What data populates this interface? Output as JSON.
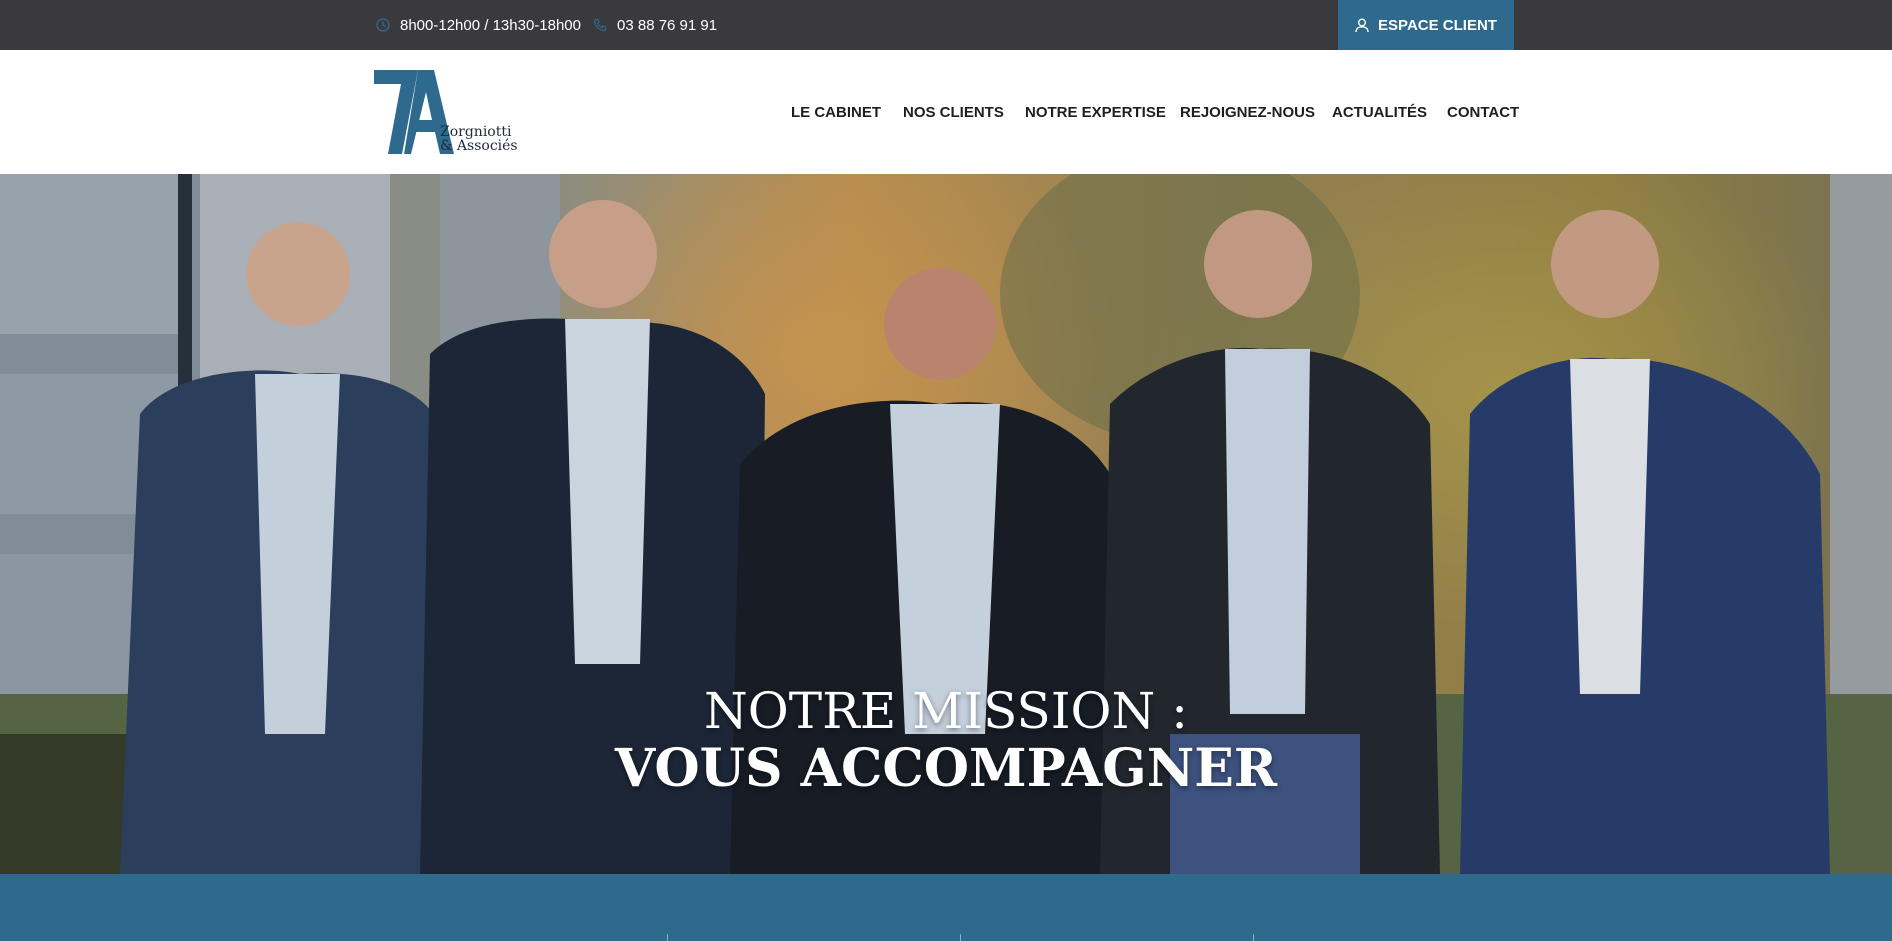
{
  "topbar": {
    "hours": "8h00-12h00 / 13h30-18h00",
    "phone": "03 88 76 91 91",
    "client_button": "ESPACE CLIENT"
  },
  "logo": {
    "mark": "7A",
    "name_line1": "Zorgniotti",
    "name_line2": "& Associés"
  },
  "nav": {
    "items": [
      {
        "label": "LE CABINET"
      },
      {
        "label": "NOS CLIENTS"
      },
      {
        "label": "NOTRE EXPERTISE"
      },
      {
        "label": "REJOIGNEZ-NOUS"
      },
      {
        "label": "ACTUALITÉS"
      },
      {
        "label": "CONTACT"
      }
    ]
  },
  "hero": {
    "title_line1": "NOTRE MISSION :",
    "title_line2": "VOUS ACCOMPAGNER"
  },
  "colors": {
    "topbar_bg": "#3a3a3c",
    "accent": "#2e6a8d",
    "nav_text": "#1f1f1f"
  },
  "icons": [
    "clock-icon",
    "phone-icon",
    "user-icon"
  ]
}
